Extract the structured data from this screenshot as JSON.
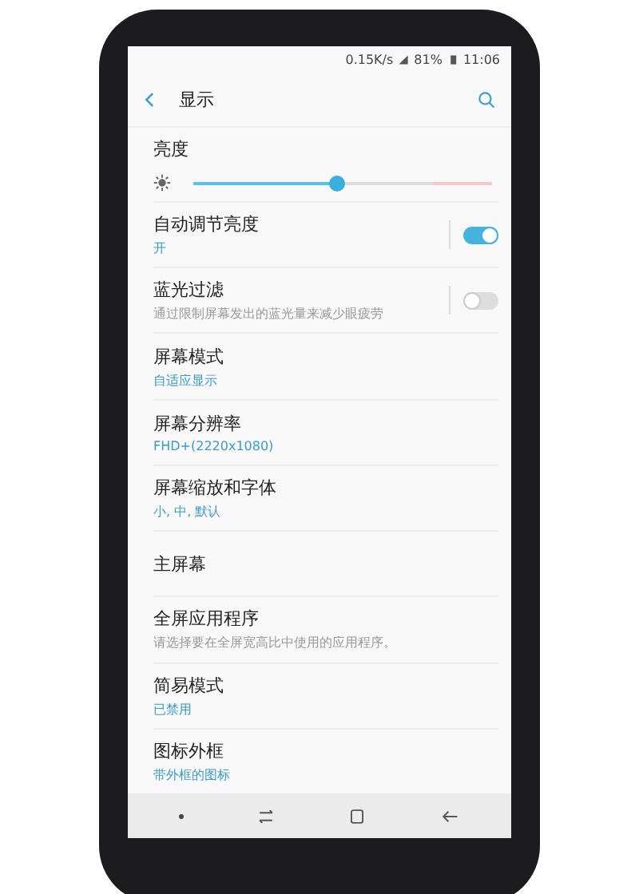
{
  "status_bar": {
    "speed": "0.15K/s",
    "battery": "81%",
    "time": "11:06"
  },
  "header": {
    "title": "显示"
  },
  "brightness": {
    "label": "亮度",
    "level": 0.48
  },
  "settings": [
    {
      "kind": "toggle",
      "title": "自动调节亮度",
      "subtitle": "开",
      "accent": true,
      "on": true
    },
    {
      "kind": "toggle",
      "title": "蓝光过滤",
      "subtitle": "通过限制屏幕发出的蓝光量来减少眼疲劳",
      "accent": false,
      "on": false
    },
    {
      "kind": "plain",
      "title": "屏幕模式",
      "subtitle": "自适应显示",
      "accent": true
    },
    {
      "kind": "plain",
      "title": "屏幕分辨率",
      "subtitle": "FHD+(2220x1080)",
      "accent": true
    },
    {
      "kind": "plain",
      "title": "屏幕缩放和字体",
      "subtitle": "小, 中, 默认",
      "accent": true
    },
    {
      "kind": "plain",
      "title": "主屏幕"
    },
    {
      "kind": "plain",
      "title": "全屏应用程序",
      "subtitle": "请选择要在全屏宽高比中使用的应用程序。",
      "accent": false
    },
    {
      "kind": "plain",
      "title": "简易模式",
      "subtitle": "已禁用",
      "accent": true
    },
    {
      "kind": "plain",
      "title": "图标外框",
      "subtitle": "带外框的图标",
      "accent": true
    }
  ]
}
